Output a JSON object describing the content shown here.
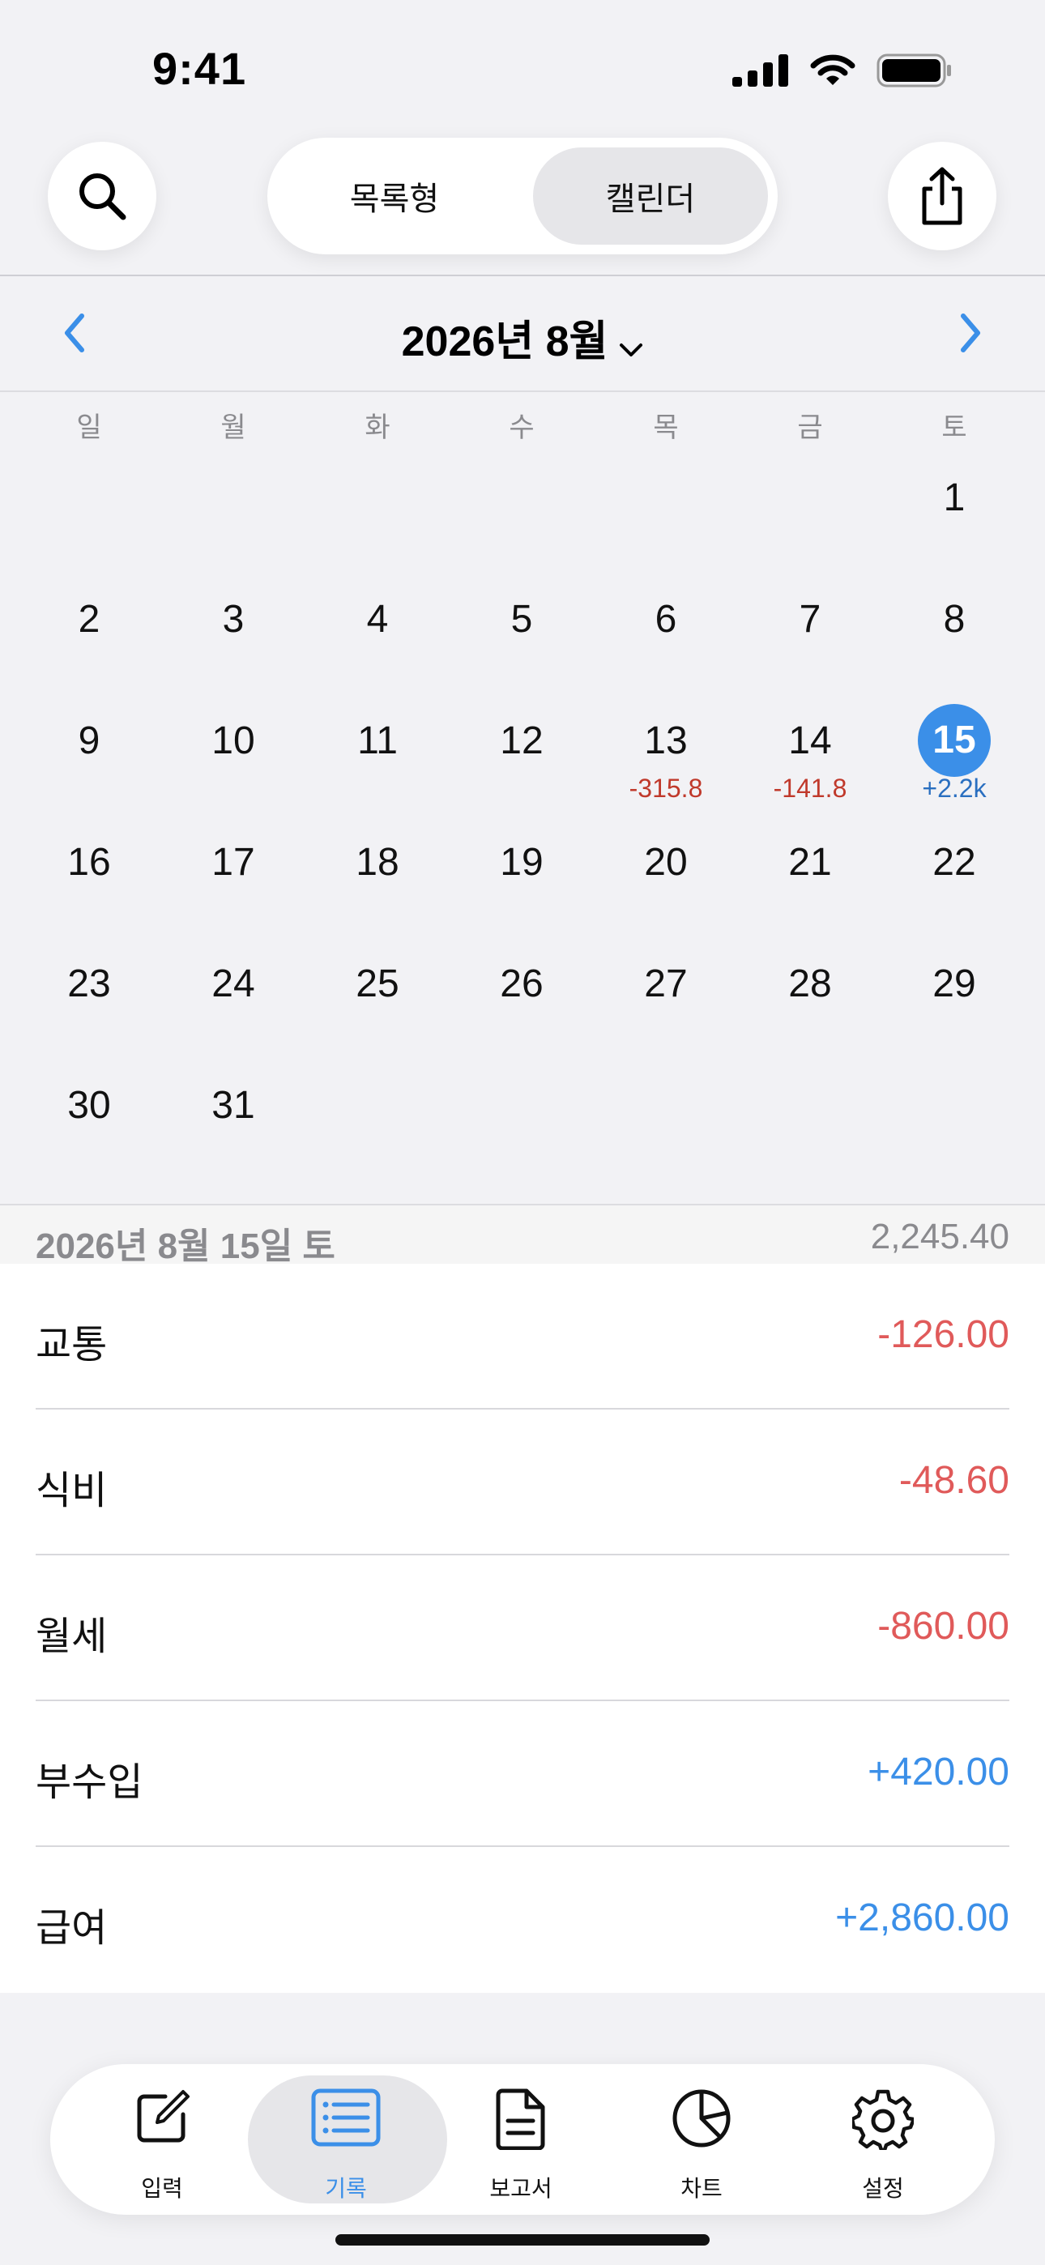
{
  "status_bar": {
    "time": "9:41"
  },
  "header": {
    "view_modes": [
      {
        "label": "목록형",
        "selected": false
      },
      {
        "label": "캘린더",
        "selected": true
      }
    ],
    "icons": {
      "search": "search-icon",
      "share": "share-icon"
    }
  },
  "month_nav": {
    "title": "2026년 8월"
  },
  "calendar": {
    "weekdays": [
      "일",
      "월",
      "화",
      "수",
      "목",
      "금",
      "토"
    ],
    "selected_day": "15",
    "days": [
      {
        "day": "1",
        "amount": ""
      },
      {
        "day": "2",
        "amount": ""
      },
      {
        "day": "3",
        "amount": ""
      },
      {
        "day": "4",
        "amount": ""
      },
      {
        "day": "5",
        "amount": ""
      },
      {
        "day": "6",
        "amount": ""
      },
      {
        "day": "7",
        "amount": ""
      },
      {
        "day": "8",
        "amount": ""
      },
      {
        "day": "9",
        "amount": ""
      },
      {
        "day": "10",
        "amount": ""
      },
      {
        "day": "11",
        "amount": ""
      },
      {
        "day": "12",
        "amount": ""
      },
      {
        "day": "13",
        "amount": "-315.8",
        "sign": "neg"
      },
      {
        "day": "14",
        "amount": "-141.8",
        "sign": "neg"
      },
      {
        "day": "15",
        "amount": "+2.2k",
        "sign": "pos"
      },
      {
        "day": "16",
        "amount": ""
      },
      {
        "day": "17",
        "amount": ""
      },
      {
        "day": "18",
        "amount": ""
      },
      {
        "day": "19",
        "amount": ""
      },
      {
        "day": "20",
        "amount": ""
      },
      {
        "day": "21",
        "amount": ""
      },
      {
        "day": "22",
        "amount": ""
      },
      {
        "day": "23",
        "amount": ""
      },
      {
        "day": "24",
        "amount": ""
      },
      {
        "day": "25",
        "amount": ""
      },
      {
        "day": "26",
        "amount": ""
      },
      {
        "day": "27",
        "amount": ""
      },
      {
        "day": "28",
        "amount": ""
      },
      {
        "day": "29",
        "amount": ""
      },
      {
        "day": "30",
        "amount": ""
      },
      {
        "day": "31",
        "amount": ""
      }
    ]
  },
  "detail": {
    "date": "2026년 8월 15일 토",
    "total": "2,245.40",
    "entries": [
      {
        "label": "교통",
        "amount": "-126.00",
        "sign": "neg"
      },
      {
        "label": "식비",
        "amount": "-48.60",
        "sign": "neg"
      },
      {
        "label": "월세",
        "amount": "-860.00",
        "sign": "neg"
      },
      {
        "label": "부수입",
        "amount": "+420.00",
        "sign": "pos"
      },
      {
        "label": "급여",
        "amount": "+2,860.00",
        "sign": "pos"
      }
    ]
  },
  "tabbar": {
    "tabs": [
      {
        "label": "입력",
        "icon": "compose-icon",
        "active": false
      },
      {
        "label": "기록",
        "icon": "list-icon",
        "active": true
      },
      {
        "label": "보고서",
        "icon": "document-icon",
        "active": false
      },
      {
        "label": "차트",
        "icon": "pie-chart-icon",
        "active": false
      },
      {
        "label": "설정",
        "icon": "gear-icon",
        "active": false
      }
    ]
  },
  "colors": {
    "accent": "#3b8fe8",
    "negative": "#e05a5a",
    "negative_small": "#c0392b",
    "positive_small": "#2a6fc0"
  }
}
